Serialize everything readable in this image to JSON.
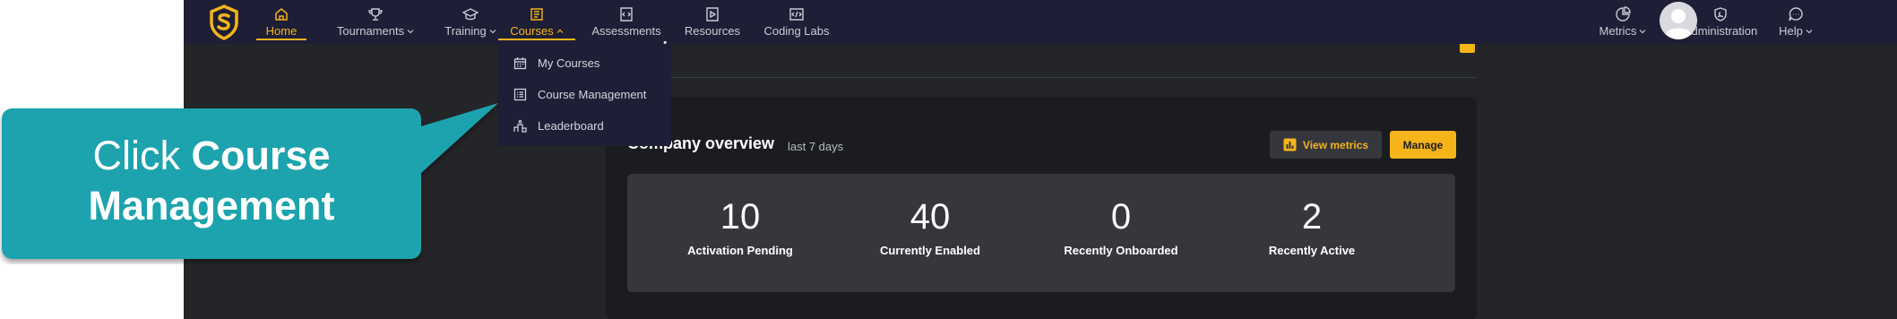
{
  "nav": {
    "items": [
      {
        "label": "Home",
        "icon": "home-icon"
      },
      {
        "label": "Tournaments",
        "icon": "trophy-icon"
      },
      {
        "label": "Training",
        "icon": "graduation-cap-icon"
      },
      {
        "label": "Courses",
        "icon": "book-icon"
      },
      {
        "label": "Assessments",
        "icon": "code-doc-icon"
      },
      {
        "label": "Resources",
        "icon": "video-file-icon"
      },
      {
        "label": "Coding Labs",
        "icon": "lab-icon"
      }
    ],
    "right_items": [
      {
        "label": "Metrics",
        "icon": "chart-icon"
      },
      {
        "label": "Administration",
        "icon": "shield-icon"
      },
      {
        "label": "Help",
        "icon": "chat-icon"
      }
    ],
    "accent": "#f5b41a"
  },
  "courses_menu": {
    "items": [
      {
        "label": "My Courses",
        "icon": "calendar-icon"
      },
      {
        "label": "Course Management",
        "icon": "list-icon"
      },
      {
        "label": "Leaderboard",
        "icon": "podium-icon"
      }
    ]
  },
  "overview": {
    "title_fragment": ":",
    "title": "Company overview",
    "subtitle": "last 7 days",
    "view_metrics": "View metrics",
    "manage": "Manage",
    "stats": [
      {
        "value": "10",
        "label": "Activation Pending"
      },
      {
        "value": "40",
        "label": "Currently Enabled"
      },
      {
        "value": "0",
        "label": "Recently Onboarded"
      },
      {
        "value": "2",
        "label": "Recently Active"
      }
    ]
  },
  "callout": {
    "prefix": "Click ",
    "bold": "Course Management",
    "color": "#1aa3ad"
  }
}
